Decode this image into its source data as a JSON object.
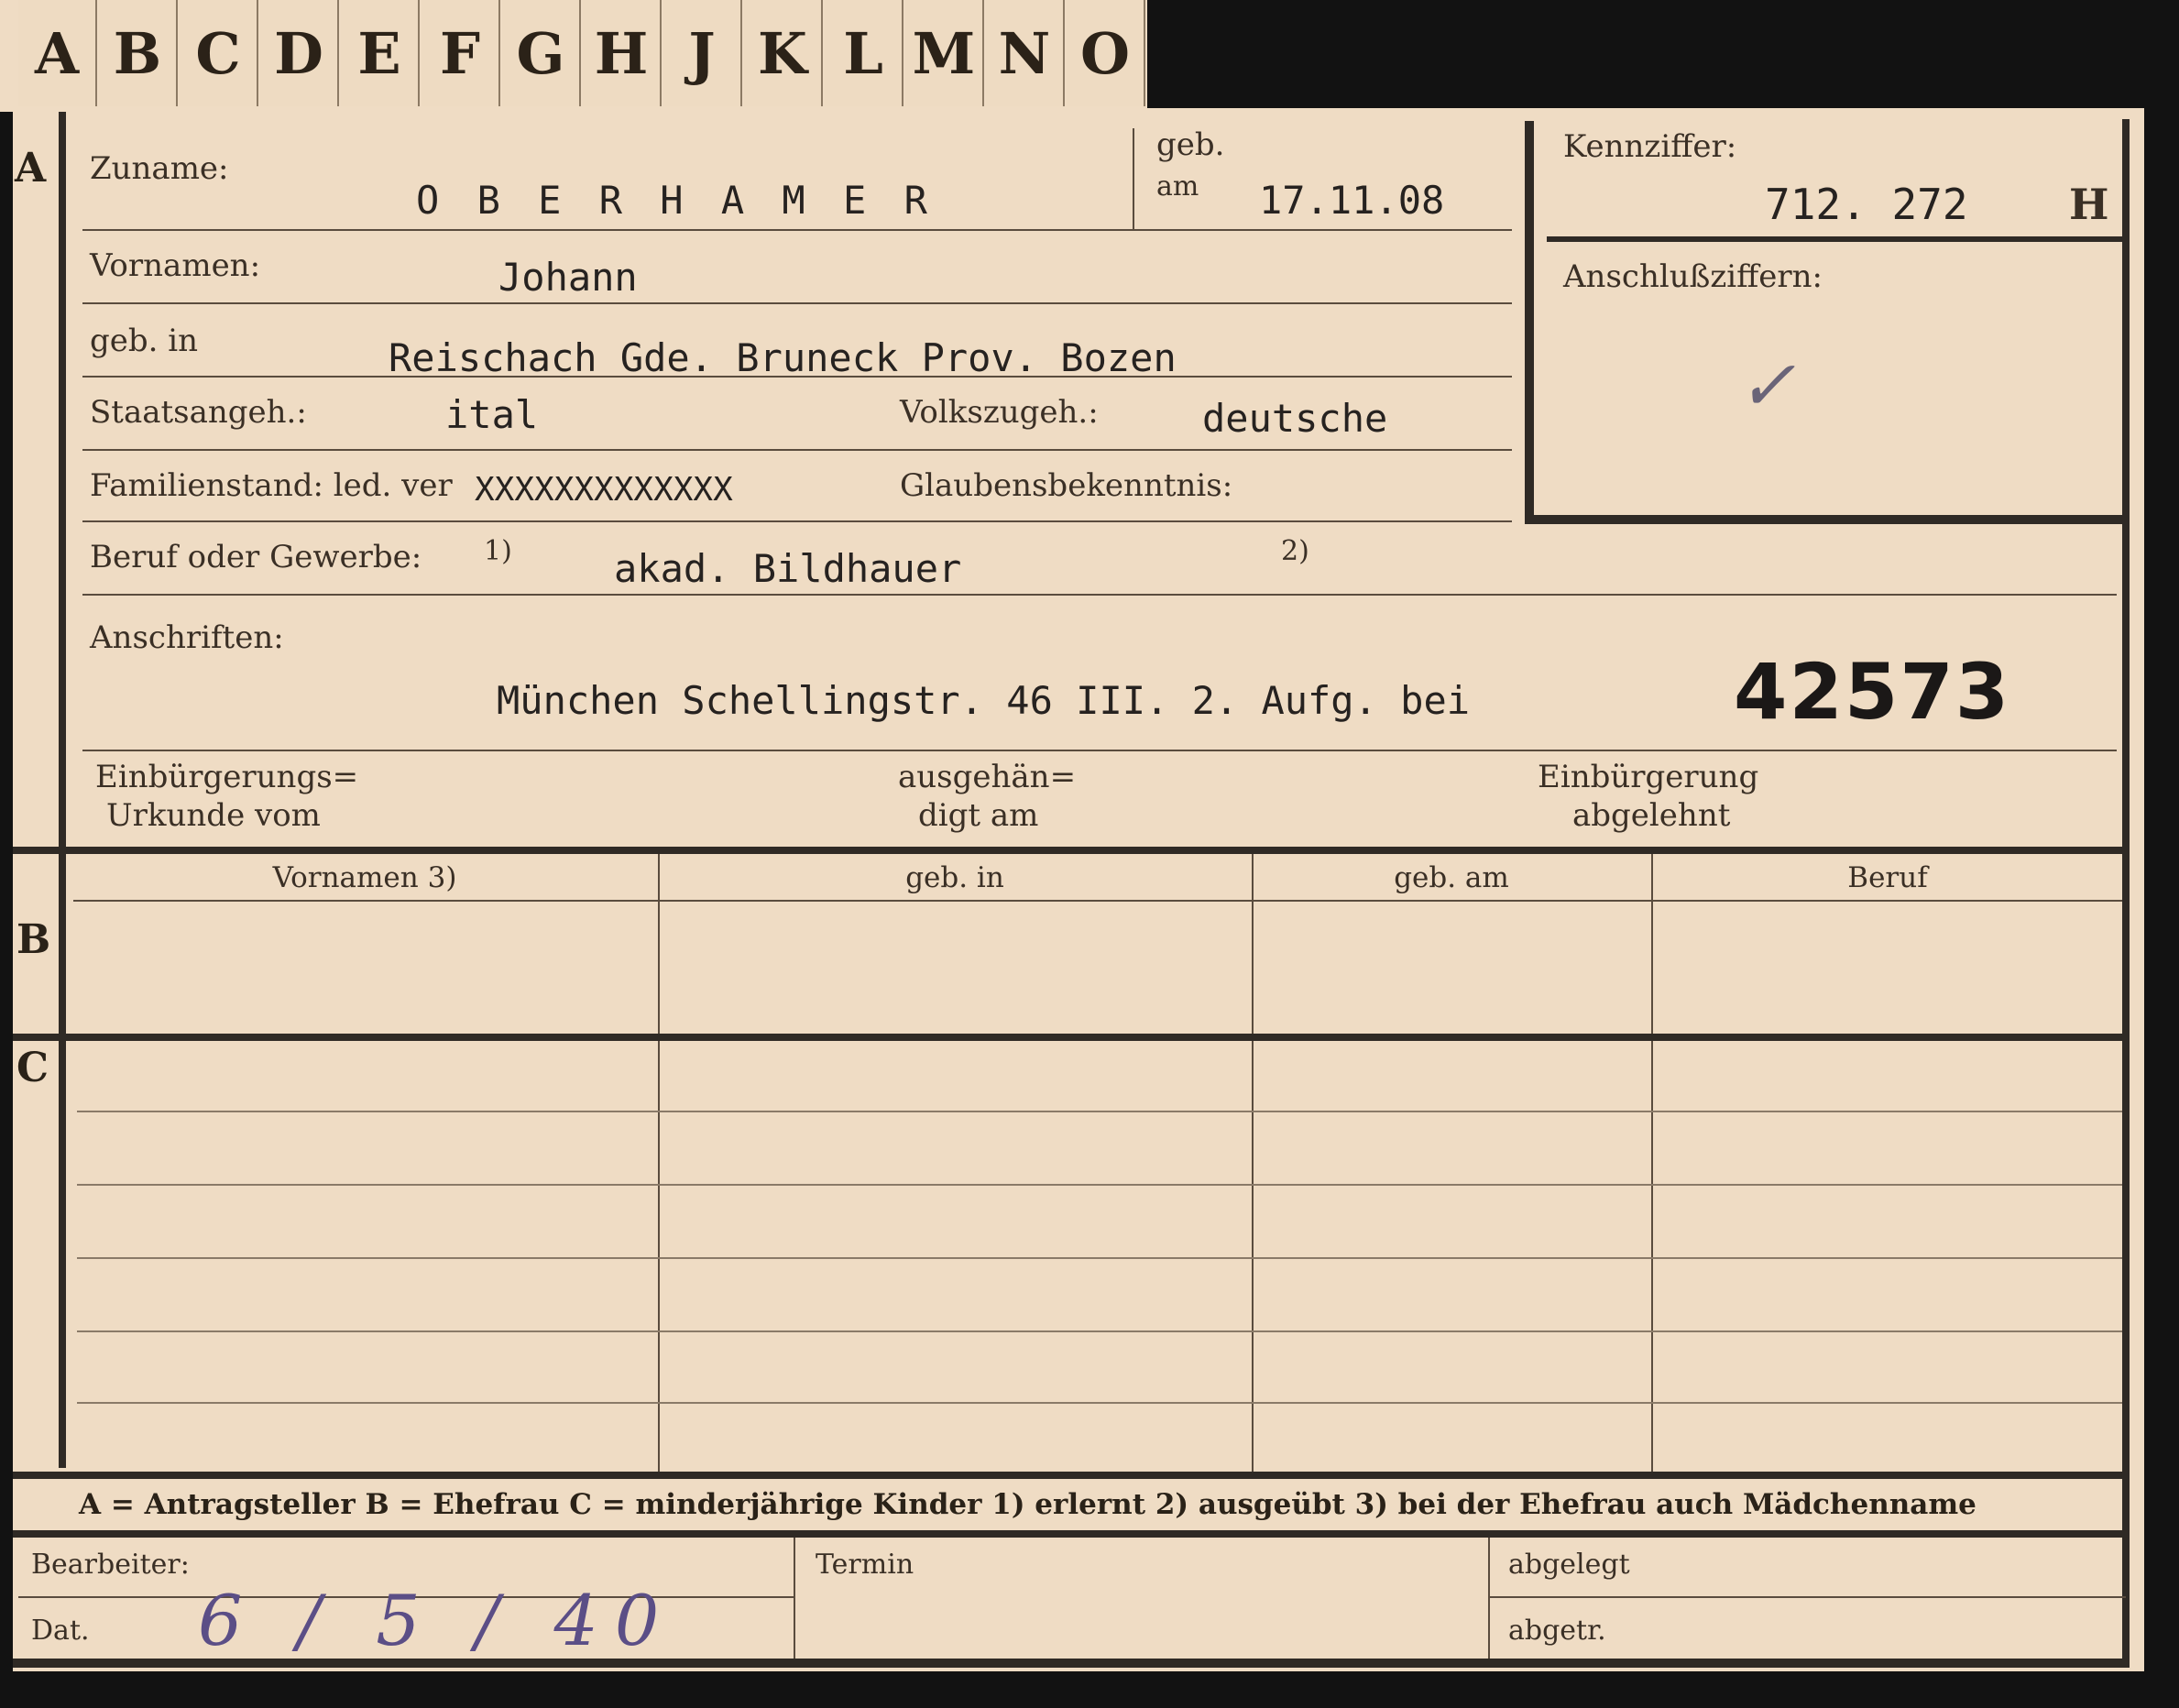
{
  "tabs": [
    "A",
    "B",
    "C",
    "D",
    "E",
    "F",
    "G",
    "H",
    "J",
    "K",
    "L",
    "M",
    "N",
    "O"
  ],
  "sections": {
    "a": "A",
    "b": "B",
    "c": "C"
  },
  "fields": {
    "zuname_label": "Zuname:",
    "zuname_value": "O B E R H A M E R",
    "geb_am_label_1": "geb.",
    "geb_am_label_2": "am",
    "geb_am_value": "17.11.08",
    "vornamen_label": "Vornamen:",
    "vornamen_value": "Johann",
    "geb_in_label": "geb. in",
    "geb_in_value": "Reischach  Gde. Bruneck Prov. Bozen",
    "staatsangeh_label": "Staatsangeh.:",
    "staatsangeh_value": "ital",
    "volkszugeh_label": "Volkszugeh.:",
    "volkszugeh_value": "deutsche",
    "familienstand_label": "Familienstand: led. ver",
    "familienstand_struck": "XXXXXXXXXXXXX",
    "glaubensbekenntnis_label": "Glaubensbekenntnis:",
    "beruf_label": "Beruf oder Gewerbe:",
    "note1": "1)",
    "beruf_value": "akad. Bildhauer",
    "note2": "2)",
    "anschriften_label": "Anschriften:",
    "anschrift_value": "München Schellingstr. 46  III. 2. Aufg. bei",
    "stamp_number": "42573",
    "einb_urkunde_1": "Einbürgerungs=",
    "einb_urkunde_2": "Urkunde vom",
    "ausgehaend_1": "ausgehän=",
    "ausgehaend_2": "digt am",
    "einb_abgelehnt_1": "Einbürgerung",
    "einb_abgelehnt_2": "abgelehnt"
  },
  "kennziffer": {
    "label": "Kennziffer:",
    "value": "712. 272",
    "suffix": "H",
    "anschluss_label": "Anschlußziffern:",
    "check_mark": "✓"
  },
  "table_b": {
    "headers": [
      "Vornamen 3)",
      "geb. in",
      "geb. am",
      "Beruf"
    ]
  },
  "legend": {
    "text": "A = Antragsteller   B = Ehefrau   C = minderjährige Kinder   1) erlernt   2) ausgeübt   3) bei der Ehefrau auch Mädchenname"
  },
  "footer": {
    "bearbeiter_label": "Bearbeiter:",
    "dat_label": "Dat.",
    "dat_value": "6 / 5 / 40",
    "termin_label": "Termin",
    "abgelegt_label": "abgelegt",
    "abgetr_label": "abgetr."
  }
}
